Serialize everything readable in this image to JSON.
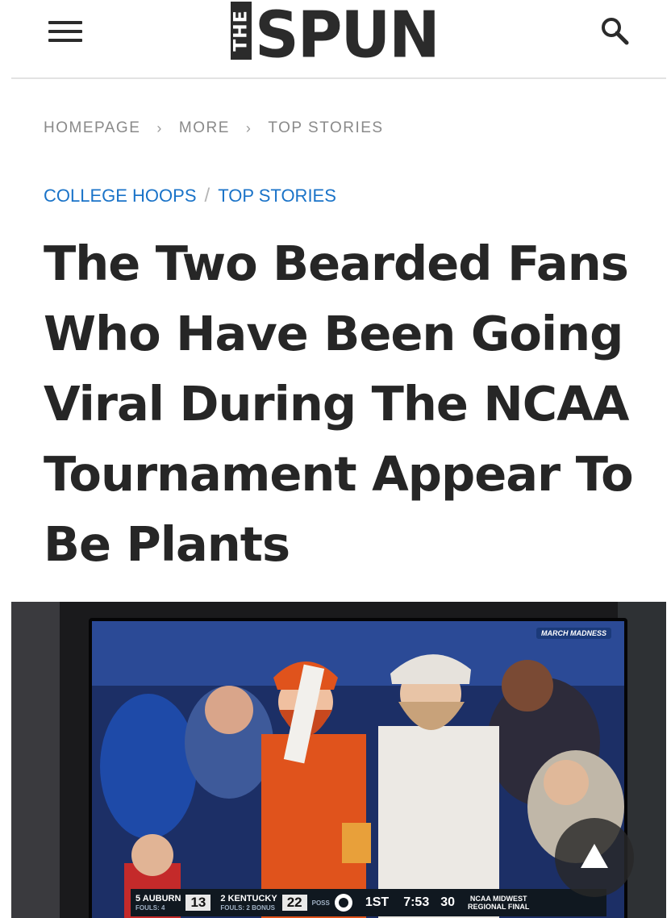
{
  "header": {
    "logo_small": "THE",
    "logo_word": "SPUN"
  },
  "breadcrumb": [
    "HOMEPAGE",
    "MORE",
    "TOP STORIES"
  ],
  "categories": [
    "COLLEGE HOOPS",
    "TOP STORIES"
  ],
  "article": {
    "title": "The Two Bearded Fans Who Have Been Going Viral During The NCAA Tournament Appear To Be Plants"
  },
  "image": {
    "badge": "MARCH MADNESS",
    "scoreboard": {
      "away_team": "AUBURN",
      "away_seed": "5",
      "away_fouls": "FOULS: 4",
      "away_score": "13",
      "home_team": "KENTUCKY",
      "home_seed": "2",
      "home_fouls": "FOULS: 2",
      "home_bonus": "BONUS",
      "home_score": "22",
      "possession": "POSS",
      "period": "1ST",
      "clock": "7:53",
      "shot_clock": "30",
      "region_line1": "NCAA MIDWEST",
      "region_line2": "REGIONAL FINAL"
    }
  },
  "colors": {
    "text_dark": "#262626",
    "breadcrumb_gray": "#8a8a8a",
    "category_blue": "#1a73c8"
  }
}
